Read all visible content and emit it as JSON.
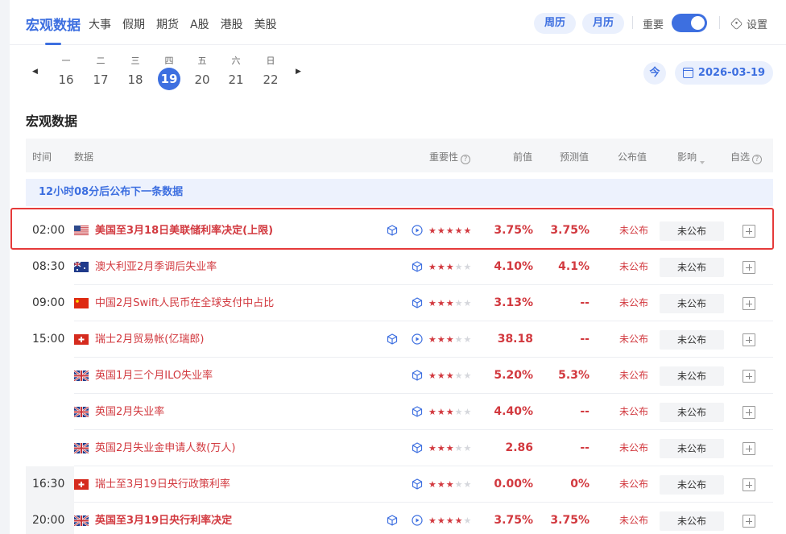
{
  "tabs": {
    "active": "宏观数据",
    "items": [
      "大事",
      "假期",
      "期货",
      "A股",
      "港股",
      "美股"
    ]
  },
  "controls": {
    "week_calendar": "周历",
    "month_calendar": "月历",
    "important_label": "重要",
    "important_on": true,
    "settings": "设置",
    "today": "今",
    "selected_date": "2026-03-19"
  },
  "week": [
    {
      "weekday": "一",
      "day": "16",
      "active": false
    },
    {
      "weekday": "二",
      "day": "17",
      "active": false
    },
    {
      "weekday": "三",
      "day": "18",
      "active": false
    },
    {
      "weekday": "四",
      "day": "19",
      "active": true
    },
    {
      "weekday": "五",
      "day": "20",
      "active": false
    },
    {
      "weekday": "六",
      "day": "21",
      "active": false
    },
    {
      "weekday": "日",
      "day": "22",
      "active": false
    }
  ],
  "section_title": "宏观数据",
  "columns": {
    "time": "时间",
    "data": "数据",
    "importance": "重要性",
    "previous": "前值",
    "forecast": "预测值",
    "actual": "公布值",
    "impact": "影响",
    "watchlist": "自选"
  },
  "notice": "12小时08分后公布下一条数据",
  "colors": {
    "accent": "#3d6fe0",
    "red": "#d2393f",
    "highlight": "#e53a3a"
  },
  "rows": [
    {
      "time": "02:00",
      "flag": "us-flag",
      "name": "美国至3月18日美联储利率决定(上限)",
      "bold": true,
      "video": true,
      "stars": 5,
      "previous": "3.75%",
      "forecast": "3.75%",
      "actual": "未公布",
      "impact": "未公布"
    },
    {
      "time": "08:30",
      "flag": "au-flag",
      "name": "澳大利亚2月季调后失业率",
      "bold": false,
      "video": false,
      "stars": 3,
      "previous": "4.10%",
      "forecast": "4.1%",
      "actual": "未公布",
      "impact": "未公布"
    },
    {
      "time": "09:00",
      "flag": "cn-flag",
      "name": "中国2月Swift人民币在全球支付中占比",
      "bold": false,
      "video": false,
      "stars": 3,
      "previous": "3.13%",
      "forecast": "--",
      "actual": "未公布",
      "impact": "未公布"
    },
    {
      "time": "15:00",
      "flag": "ch-flag",
      "name": "瑞士2月贸易帐(亿瑞郎)",
      "bold": false,
      "video": true,
      "stars": 3,
      "previous": "38.18",
      "forecast": "--",
      "actual": "未公布",
      "impact": "未公布"
    },
    {
      "time": "",
      "flag": "uk-flag",
      "name": "英国1月三个月ILO失业率",
      "bold": false,
      "video": false,
      "stars": 3,
      "previous": "5.20%",
      "forecast": "5.3%",
      "actual": "未公布",
      "impact": "未公布"
    },
    {
      "time": "",
      "flag": "uk-flag",
      "name": "英国2月失业率",
      "bold": false,
      "video": false,
      "stars": 3,
      "previous": "4.40%",
      "forecast": "--",
      "actual": "未公布",
      "impact": "未公布"
    },
    {
      "time": "",
      "flag": "uk-flag",
      "name": "英国2月失业金申请人数(万人)",
      "bold": false,
      "video": false,
      "stars": 3,
      "previous": "2.86",
      "forecast": "--",
      "actual": "未公布",
      "impact": "未公布"
    },
    {
      "time": "16:30",
      "flag": "ch-flag",
      "name": "瑞士至3月19日央行政策利率",
      "bold": false,
      "video": false,
      "stars": 3,
      "previous": "0.00%",
      "forecast": "0%",
      "actual": "未公布",
      "impact": "未公布"
    },
    {
      "time": "20:00",
      "flag": "uk-flag",
      "name": "英国至3月19日央行利率决定",
      "bold": true,
      "video": true,
      "stars": 4,
      "previous": "3.75%",
      "forecast": "3.75%",
      "actual": "未公布",
      "impact": "未公布"
    }
  ]
}
